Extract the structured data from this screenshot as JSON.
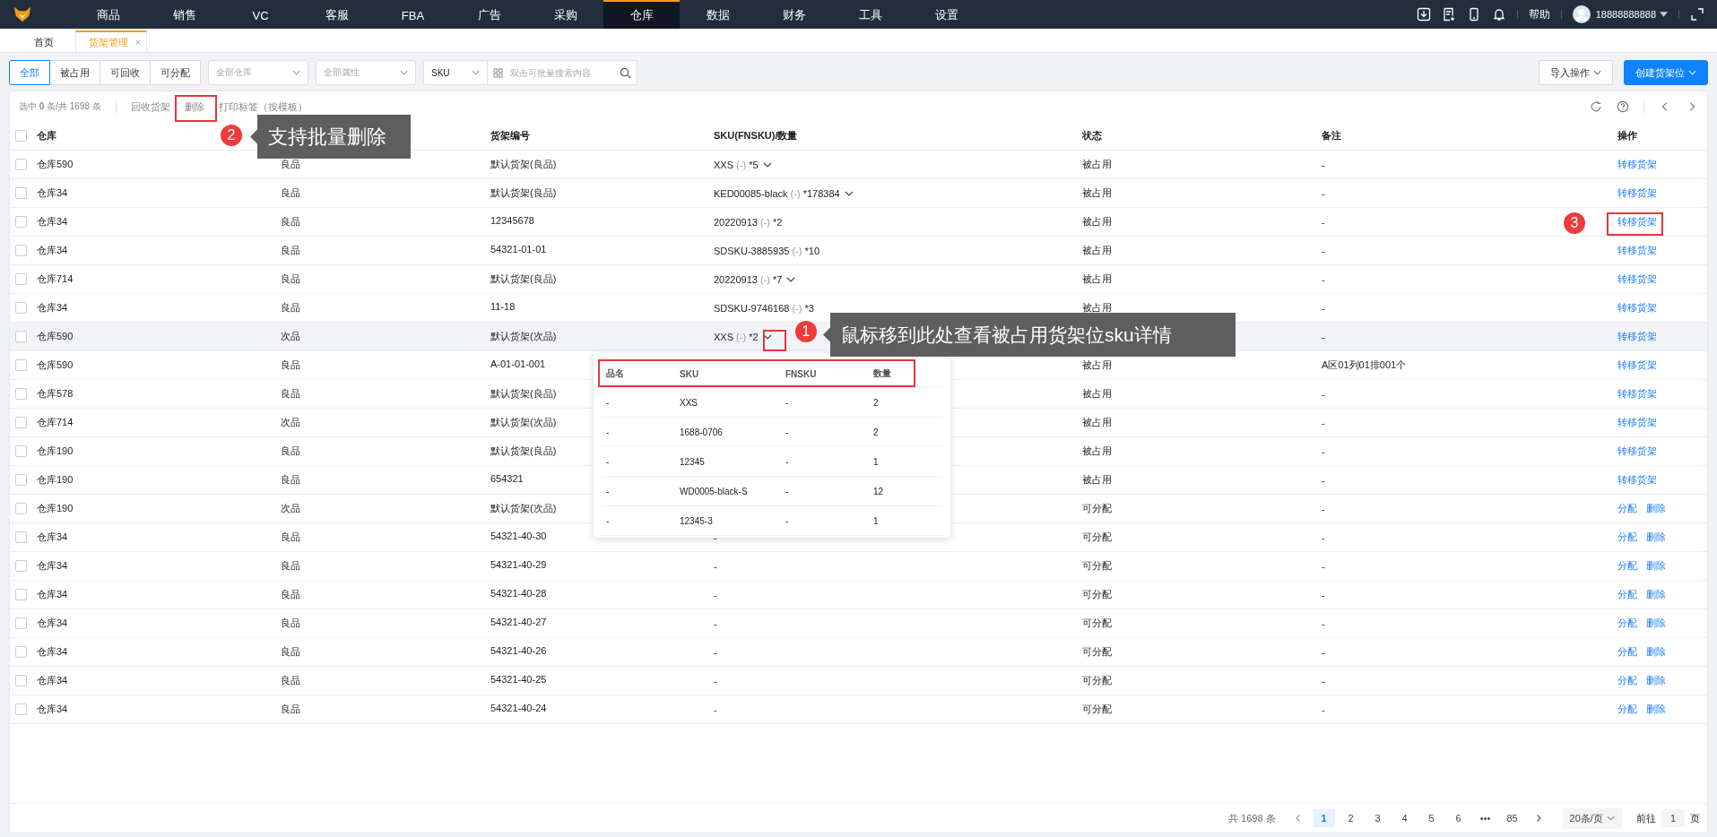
{
  "nav": {
    "items": [
      {
        "label": "商品",
        "selected": false
      },
      {
        "label": "销售",
        "selected": false
      },
      {
        "label": "VC",
        "selected": false
      },
      {
        "label": "客服",
        "selected": false
      },
      {
        "label": "FBA",
        "selected": false
      },
      {
        "label": "广告",
        "selected": false
      },
      {
        "label": "采购",
        "selected": false
      },
      {
        "label": "仓库",
        "selected": true
      },
      {
        "label": "数据",
        "selected": false
      },
      {
        "label": "财务",
        "selected": false
      },
      {
        "label": "工具",
        "selected": false
      },
      {
        "label": "设置",
        "selected": false
      }
    ],
    "help": "帮助",
    "user": "18888888888"
  },
  "tabs": [
    {
      "label": "首页",
      "selected": false,
      "closable": false
    },
    {
      "label": "货架管理",
      "selected": true,
      "closable": true,
      "close": "×"
    }
  ],
  "filters": {
    "segments": [
      {
        "label": "全部",
        "selected": true
      },
      {
        "label": "被占用",
        "selected": false
      },
      {
        "label": "可回收",
        "selected": false
      },
      {
        "label": "可分配",
        "selected": false
      }
    ],
    "warehouse": {
      "placeholder": "全部仓库"
    },
    "attribute": {
      "placeholder": "全部属性"
    },
    "search_type": {
      "value": "SKU"
    },
    "search": {
      "placeholder": "双击可批量搜索内容"
    },
    "import_button": "导入操作",
    "create_button": "创建货架位"
  },
  "action_bar": {
    "selection": "选中 **0** 条/共 1698 条",
    "actions": [
      "回收货架",
      "删除",
      "打印标签（按模板）"
    ]
  },
  "table": {
    "all_checked": false,
    "columns": [
      "仓库",
      null,
      "货架编号",
      "SKU(FNSKU)/数量",
      "状态",
      "备注",
      "操作"
    ],
    "rows": [
      {
        "warehouse": "仓库590",
        "grade": "良品",
        "shelf": "默认货架(良品)",
        "sku": {
          "kind": "item",
          "code": "XXS",
          "fnsku": "(-)",
          "qty": "*5",
          "expandable": true
        },
        "status": "被占用",
        "remark": "-",
        "actions": [
          "转移货架"
        ],
        "highlighted": false
      },
      {
        "warehouse": "仓库34",
        "grade": "良品",
        "shelf": "默认货架(良品)",
        "sku": {
          "kind": "item",
          "code": "KED00085-black",
          "fnsku": "(-)",
          "qty": "*178384",
          "expandable": true
        },
        "status": "被占用",
        "remark": "-",
        "actions": [
          "转移货架"
        ],
        "highlighted": false
      },
      {
        "warehouse": "仓库34",
        "grade": "良品",
        "shelf": "12345678",
        "sku": {
          "kind": "item",
          "code": "20220913",
          "fnsku": "(-)",
          "qty": "*2",
          "expandable": false
        },
        "status": "被占用",
        "remark": "-",
        "actions": [
          "转移货架"
        ],
        "highlighted": false
      },
      {
        "warehouse": "仓库34",
        "grade": "良品",
        "shelf": "54321-01-01",
        "sku": {
          "kind": "item",
          "code": "SDSKU-3885935",
          "fnsku": "(-)",
          "qty": "*10",
          "expandable": false
        },
        "status": "被占用",
        "remark": "-",
        "actions": [
          "转移货架"
        ],
        "highlighted": false
      },
      {
        "warehouse": "仓库714",
        "grade": "良品",
        "shelf": "默认货架(良品)",
        "sku": {
          "kind": "item",
          "code": "20220913",
          "fnsku": "(-)",
          "qty": "*7",
          "expandable": true
        },
        "status": "被占用",
        "remark": "-",
        "actions": [
          "转移货架"
        ],
        "highlighted": false
      },
      {
        "warehouse": "仓库34",
        "grade": "良品",
        "shelf": "11-18",
        "sku": {
          "kind": "item",
          "code": "SDSKU-9746168",
          "fnsku": "(-)",
          "qty": "*3",
          "expandable": false
        },
        "status": "被占用",
        "remark": "-",
        "actions": [
          "转移货架"
        ],
        "highlighted": false
      },
      {
        "warehouse": "仓库590",
        "grade": "次品",
        "shelf": "默认货架(次品)",
        "sku": {
          "kind": "item",
          "code": "XXS",
          "fnsku": "(-)",
          "qty": "*2",
          "expandable": true
        },
        "remark": "-",
        "actions": [
          "转移货架"
        ],
        "highlighted": true
      },
      {
        "warehouse": "仓库590",
        "grade": "良品",
        "shelf": "A-01-01-001",
        "status": "被占用",
        "remark": "A区01列01排001个",
        "actions": [
          "转移货架"
        ],
        "highlighted": false
      },
      {
        "warehouse": "仓库578",
        "grade": "良品",
        "shelf": "默认货架(良品)",
        "status": "被占用",
        "remark": "-",
        "actions": [
          "转移货架"
        ],
        "highlighted": false
      },
      {
        "warehouse": "仓库714",
        "grade": "次品",
        "shelf": "默认货架(次品)",
        "status": "被占用",
        "remark": "-",
        "actions": [
          "转移货架"
        ],
        "highlighted": false
      },
      {
        "warehouse": "仓库190",
        "grade": "良品",
        "shelf": "默认货架(良品)",
        "status": "被占用",
        "remark": "-",
        "actions": [
          "转移货架"
        ],
        "highlighted": false
      },
      {
        "warehouse": "仓库190",
        "grade": "良品",
        "shelf": "654321",
        "status": "被占用",
        "remark": "-",
        "actions": [
          "转移货架"
        ],
        "highlighted": false
      },
      {
        "warehouse": "仓库190",
        "grade": "次品",
        "shelf": "默认货架(次品)",
        "status": "可分配",
        "remark": "-",
        "actions": [
          "分配",
          "删除"
        ],
        "highlighted": false
      },
      {
        "warehouse": "仓库34",
        "grade": "良品",
        "shelf": "54321-40-30",
        "sku": {
          "kind": "empty",
          "text": "-"
        },
        "status": "可分配",
        "remark": "-",
        "actions": [
          "分配",
          "删除"
        ],
        "highlighted": false
      },
      {
        "warehouse": "仓库34",
        "grade": "良品",
        "shelf": "54321-40-29",
        "sku": {
          "kind": "empty",
          "text": "-"
        },
        "status": "可分配",
        "remark": "-",
        "actions": [
          "分配",
          "删除"
        ],
        "highlighted": false
      },
      {
        "warehouse": "仓库34",
        "grade": "良品",
        "shelf": "54321-40-28",
        "sku": {
          "kind": "empty",
          "text": "-"
        },
        "status": "可分配",
        "remark": "-",
        "actions": [
          "分配",
          "删除"
        ],
        "highlighted": false
      },
      {
        "warehouse": "仓库34",
        "grade": "良品",
        "shelf": "54321-40-27",
        "sku": {
          "kind": "empty",
          "text": "-"
        },
        "status": "可分配",
        "remark": "-",
        "actions": [
          "分配",
          "删除"
        ],
        "highlighted": false
      },
      {
        "warehouse": "仓库34",
        "grade": "良品",
        "shelf": "54321-40-26",
        "sku": {
          "kind": "empty",
          "text": "-"
        },
        "status": "可分配",
        "remark": "-",
        "actions": [
          "分配",
          "删除"
        ],
        "highlighted": false
      },
      {
        "warehouse": "仓库34",
        "grade": "良品",
        "shelf": "54321-40-25",
        "sku": {
          "kind": "empty",
          "text": "-"
        },
        "status": "可分配",
        "remark": "-",
        "actions": [
          "分配",
          "删除"
        ],
        "highlighted": false
      },
      {
        "warehouse": "仓库34",
        "grade": "良品",
        "shelf": "54321-40-24",
        "sku": {
          "kind": "empty",
          "text": "-"
        },
        "status": "可分配",
        "remark": "-",
        "actions": [
          "分配",
          "删除"
        ],
        "highlighted": false
      }
    ]
  },
  "sku_popup": {
    "columns": [
      "品名",
      "SKU",
      "FNSKU",
      "数量"
    ],
    "rows": [
      [
        "-",
        "XXS",
        "-",
        "2"
      ],
      [
        "-",
        "1688-0706",
        "-",
        "2"
      ],
      [
        "-",
        "12345",
        "-",
        "1"
      ],
      [
        "-",
        "WD0005-black-S",
        "-",
        "12"
      ],
      [
        "-",
        "12345-3",
        "-",
        "1"
      ]
    ]
  },
  "pagination": {
    "total": "共 1698 条",
    "pages": [
      {
        "label": "1",
        "selected": true
      },
      {
        "label": "2",
        "selected": false
      },
      {
        "label": "3",
        "selected": false
      },
      {
        "label": "4",
        "selected": false
      },
      {
        "label": "5",
        "selected": false
      },
      {
        "label": "6",
        "selected": false
      },
      {
        "label": "•••",
        "selected": false
      },
      {
        "label": "85",
        "selected": false
      }
    ],
    "page_size": "20条/页",
    "goto": "前往",
    "goto_value": "1",
    "page_unit": "页"
  },
  "annotations": [
    {
      "number": "1",
      "text": "鼠标移到此处查看被占用货架位sku详情"
    },
    {
      "number": "2",
      "text": "支持批量删除"
    },
    {
      "number": "3"
    }
  ]
}
